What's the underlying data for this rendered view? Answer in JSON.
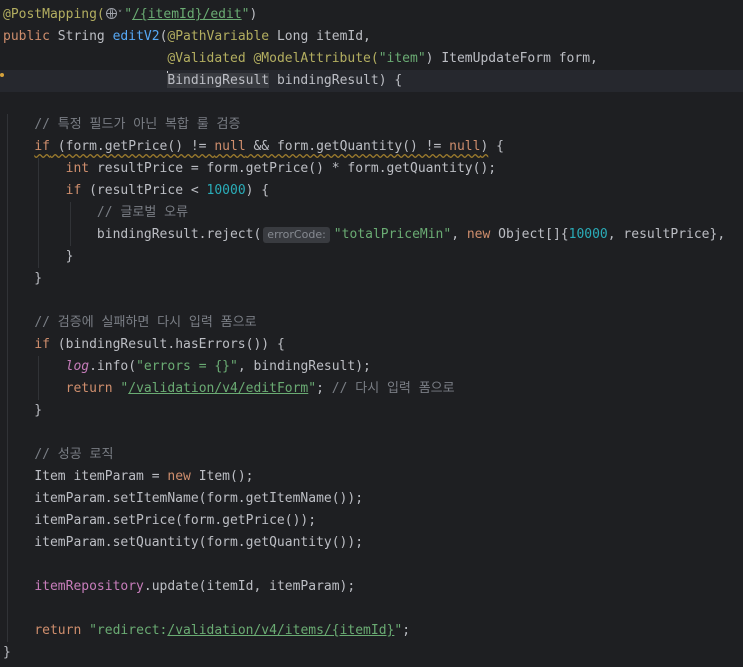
{
  "editor": {
    "lines": [
      [
        {
          "t": "@PostMapping(",
          "c": "ann"
        },
        {
          "t": "",
          "c": "globe"
        },
        {
          "t": "",
          "c": "chev"
        },
        {
          "t": "\"",
          "c": "str"
        },
        {
          "t": "/{itemId}/edit",
          "c": "str",
          "link": true
        },
        {
          "t": "\"",
          "c": "str"
        },
        {
          "t": ")",
          "c": "plain"
        }
      ],
      [
        {
          "t": "public ",
          "c": "kw"
        },
        {
          "t": "String ",
          "c": "plain"
        },
        {
          "t": "editV2",
          "c": "fn"
        },
        {
          "t": "(",
          "c": "plain"
        },
        {
          "t": "@PathVariable ",
          "c": "ann"
        },
        {
          "t": "Long itemId,",
          "c": "plain"
        }
      ],
      [
        {
          "t": "                     ",
          "c": "plain"
        },
        {
          "t": "@Validated @ModelAttribute(",
          "c": "ann"
        },
        {
          "t": "\"item\"",
          "c": "str"
        },
        {
          "t": ") ItemUpdateForm form,",
          "c": "plain"
        }
      ],
      [
        {
          "t": "                     ",
          "c": "plain"
        },
        {
          "t": "",
          "c": "caret"
        },
        {
          "t": "BindingResult",
          "c": "caretbox"
        },
        {
          "t": " bindingResult) {",
          "c": "plain"
        }
      ],
      [],
      [
        {
          "t": "    ",
          "c": "plain"
        },
        {
          "t": "// 특정 필드가 아닌 복합 룰 검증",
          "c": "cmt"
        }
      ],
      [
        {
          "t": "    ",
          "c": "plain"
        },
        {
          "t": "if",
          "c": "kw",
          "warn": true
        },
        {
          "t": " (form.getPrice() != ",
          "c": "plain",
          "warn": true
        },
        {
          "t": "null",
          "c": "kw",
          "warn": true
        },
        {
          "t": " && form.getQuantity() != ",
          "c": "plain",
          "warn": true
        },
        {
          "t": "null",
          "c": "kw",
          "warn": true
        },
        {
          "t": ")",
          "c": "plain",
          "warn": true
        },
        {
          "t": " {",
          "c": "plain"
        }
      ],
      [
        {
          "t": "        ",
          "c": "plain"
        },
        {
          "t": "int ",
          "c": "kw"
        },
        {
          "t": "resultPrice = form.getPrice() * form.getQuantity();",
          "c": "plain"
        }
      ],
      [
        {
          "t": "        ",
          "c": "plain"
        },
        {
          "t": "if ",
          "c": "kw"
        },
        {
          "t": "(resultPrice < ",
          "c": "plain"
        },
        {
          "t": "10000",
          "c": "num"
        },
        {
          "t": ") {",
          "c": "plain"
        }
      ],
      [
        {
          "t": "            ",
          "c": "plain"
        },
        {
          "t": "// 글로벌 오류",
          "c": "cmt"
        }
      ],
      [
        {
          "t": "            ",
          "c": "plain"
        },
        {
          "t": "bindingResult.reject(",
          "c": "plain"
        },
        {
          "t": "errorCode:",
          "c": "hint"
        },
        {
          "t": "\"totalPriceMin\"",
          "c": "str"
        },
        {
          "t": ", ",
          "c": "plain"
        },
        {
          "t": "new ",
          "c": "kw"
        },
        {
          "t": "Object[]{",
          "c": "plain"
        },
        {
          "t": "10000",
          "c": "num"
        },
        {
          "t": ", resultPrice}, ",
          "c": "plain"
        }
      ],
      [
        {
          "t": "        }",
          "c": "plain"
        }
      ],
      [
        {
          "t": "    }",
          "c": "plain"
        }
      ],
      [],
      [
        {
          "t": "    ",
          "c": "plain"
        },
        {
          "t": "// 검증에 실패하면 다시 입력 폼으로",
          "c": "cmt"
        }
      ],
      [
        {
          "t": "    ",
          "c": "plain"
        },
        {
          "t": "if ",
          "c": "kw"
        },
        {
          "t": "(bindingResult.hasErrors()) {",
          "c": "plain"
        }
      ],
      [
        {
          "t": "        ",
          "c": "plain"
        },
        {
          "t": "log",
          "c": "static"
        },
        {
          "t": ".info(",
          "c": "plain"
        },
        {
          "t": "\"errors = {}\"",
          "c": "str"
        },
        {
          "t": ", bindingResult);",
          "c": "plain"
        }
      ],
      [
        {
          "t": "        ",
          "c": "plain"
        },
        {
          "t": "return ",
          "c": "kw"
        },
        {
          "t": "\"",
          "c": "str"
        },
        {
          "t": "/validation/v4/editForm",
          "c": "str",
          "link": true
        },
        {
          "t": "\"",
          "c": "str"
        },
        {
          "t": "; ",
          "c": "plain"
        },
        {
          "t": "// 다시 입력 폼으로",
          "c": "cmt"
        }
      ],
      [
        {
          "t": "    }",
          "c": "plain"
        }
      ],
      [],
      [
        {
          "t": "    ",
          "c": "plain"
        },
        {
          "t": "// 성공 로직",
          "c": "cmt"
        }
      ],
      [
        {
          "t": "    ",
          "c": "plain"
        },
        {
          "t": "Item itemParam = ",
          "c": "plain"
        },
        {
          "t": "new ",
          "c": "kw"
        },
        {
          "t": "Item();",
          "c": "plain"
        }
      ],
      [
        {
          "t": "    itemParam.setItemName(form.getItemName());",
          "c": "plain"
        }
      ],
      [
        {
          "t": "    itemParam.setPrice(form.getPrice());",
          "c": "plain"
        }
      ],
      [
        {
          "t": "    itemParam.setQuantity(form.getQuantity());",
          "c": "plain"
        }
      ],
      [],
      [
        {
          "t": "    ",
          "c": "plain"
        },
        {
          "t": "itemRepository",
          "c": "field"
        },
        {
          "t": ".update(itemId, itemParam);",
          "c": "plain"
        }
      ],
      [],
      [
        {
          "t": "    ",
          "c": "plain"
        },
        {
          "t": "return ",
          "c": "kw"
        },
        {
          "t": "\"redirect:",
          "c": "str"
        },
        {
          "t": "/validation/v4/items/{itemId}",
          "c": "str",
          "link": true
        },
        {
          "t": "\"",
          "c": "str"
        },
        {
          "t": ";",
          "c": "plain"
        }
      ],
      [
        {
          "t": "}",
          "c": "plain"
        }
      ]
    ]
  }
}
